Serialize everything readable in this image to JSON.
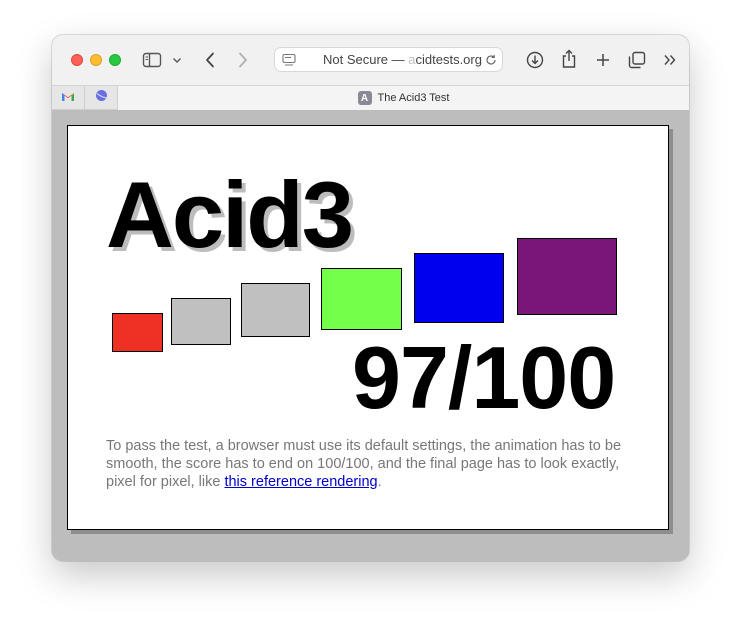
{
  "browser": {
    "address": {
      "prefix": "Not Secure — ",
      "faded": "a",
      "domain": "cidtests.org"
    },
    "pinned_tabs": [
      {
        "icon": "gmail-icon"
      },
      {
        "icon": "planet-icon"
      }
    ],
    "active_tab": {
      "favicon_letter": "A",
      "title": "The Acid3 Test"
    }
  },
  "page": {
    "heading": "Acid3",
    "score": "97/100",
    "description_text": "To pass the test, a browser must use its default settings, the animation has to be smooth, the score has to end on 100/100, and the final page has to look exactly, pixel for pixel, like ",
    "link_text": "this reference rendering",
    "description_end": ".",
    "boxes": [
      {
        "color": "#ee3124"
      },
      {
        "color": "#c0c0c0"
      },
      {
        "color": "#c0c0c0"
      },
      {
        "color": "#74ff4a"
      },
      {
        "color": "#0000ee"
      },
      {
        "color": "#7a1679"
      }
    ]
  }
}
